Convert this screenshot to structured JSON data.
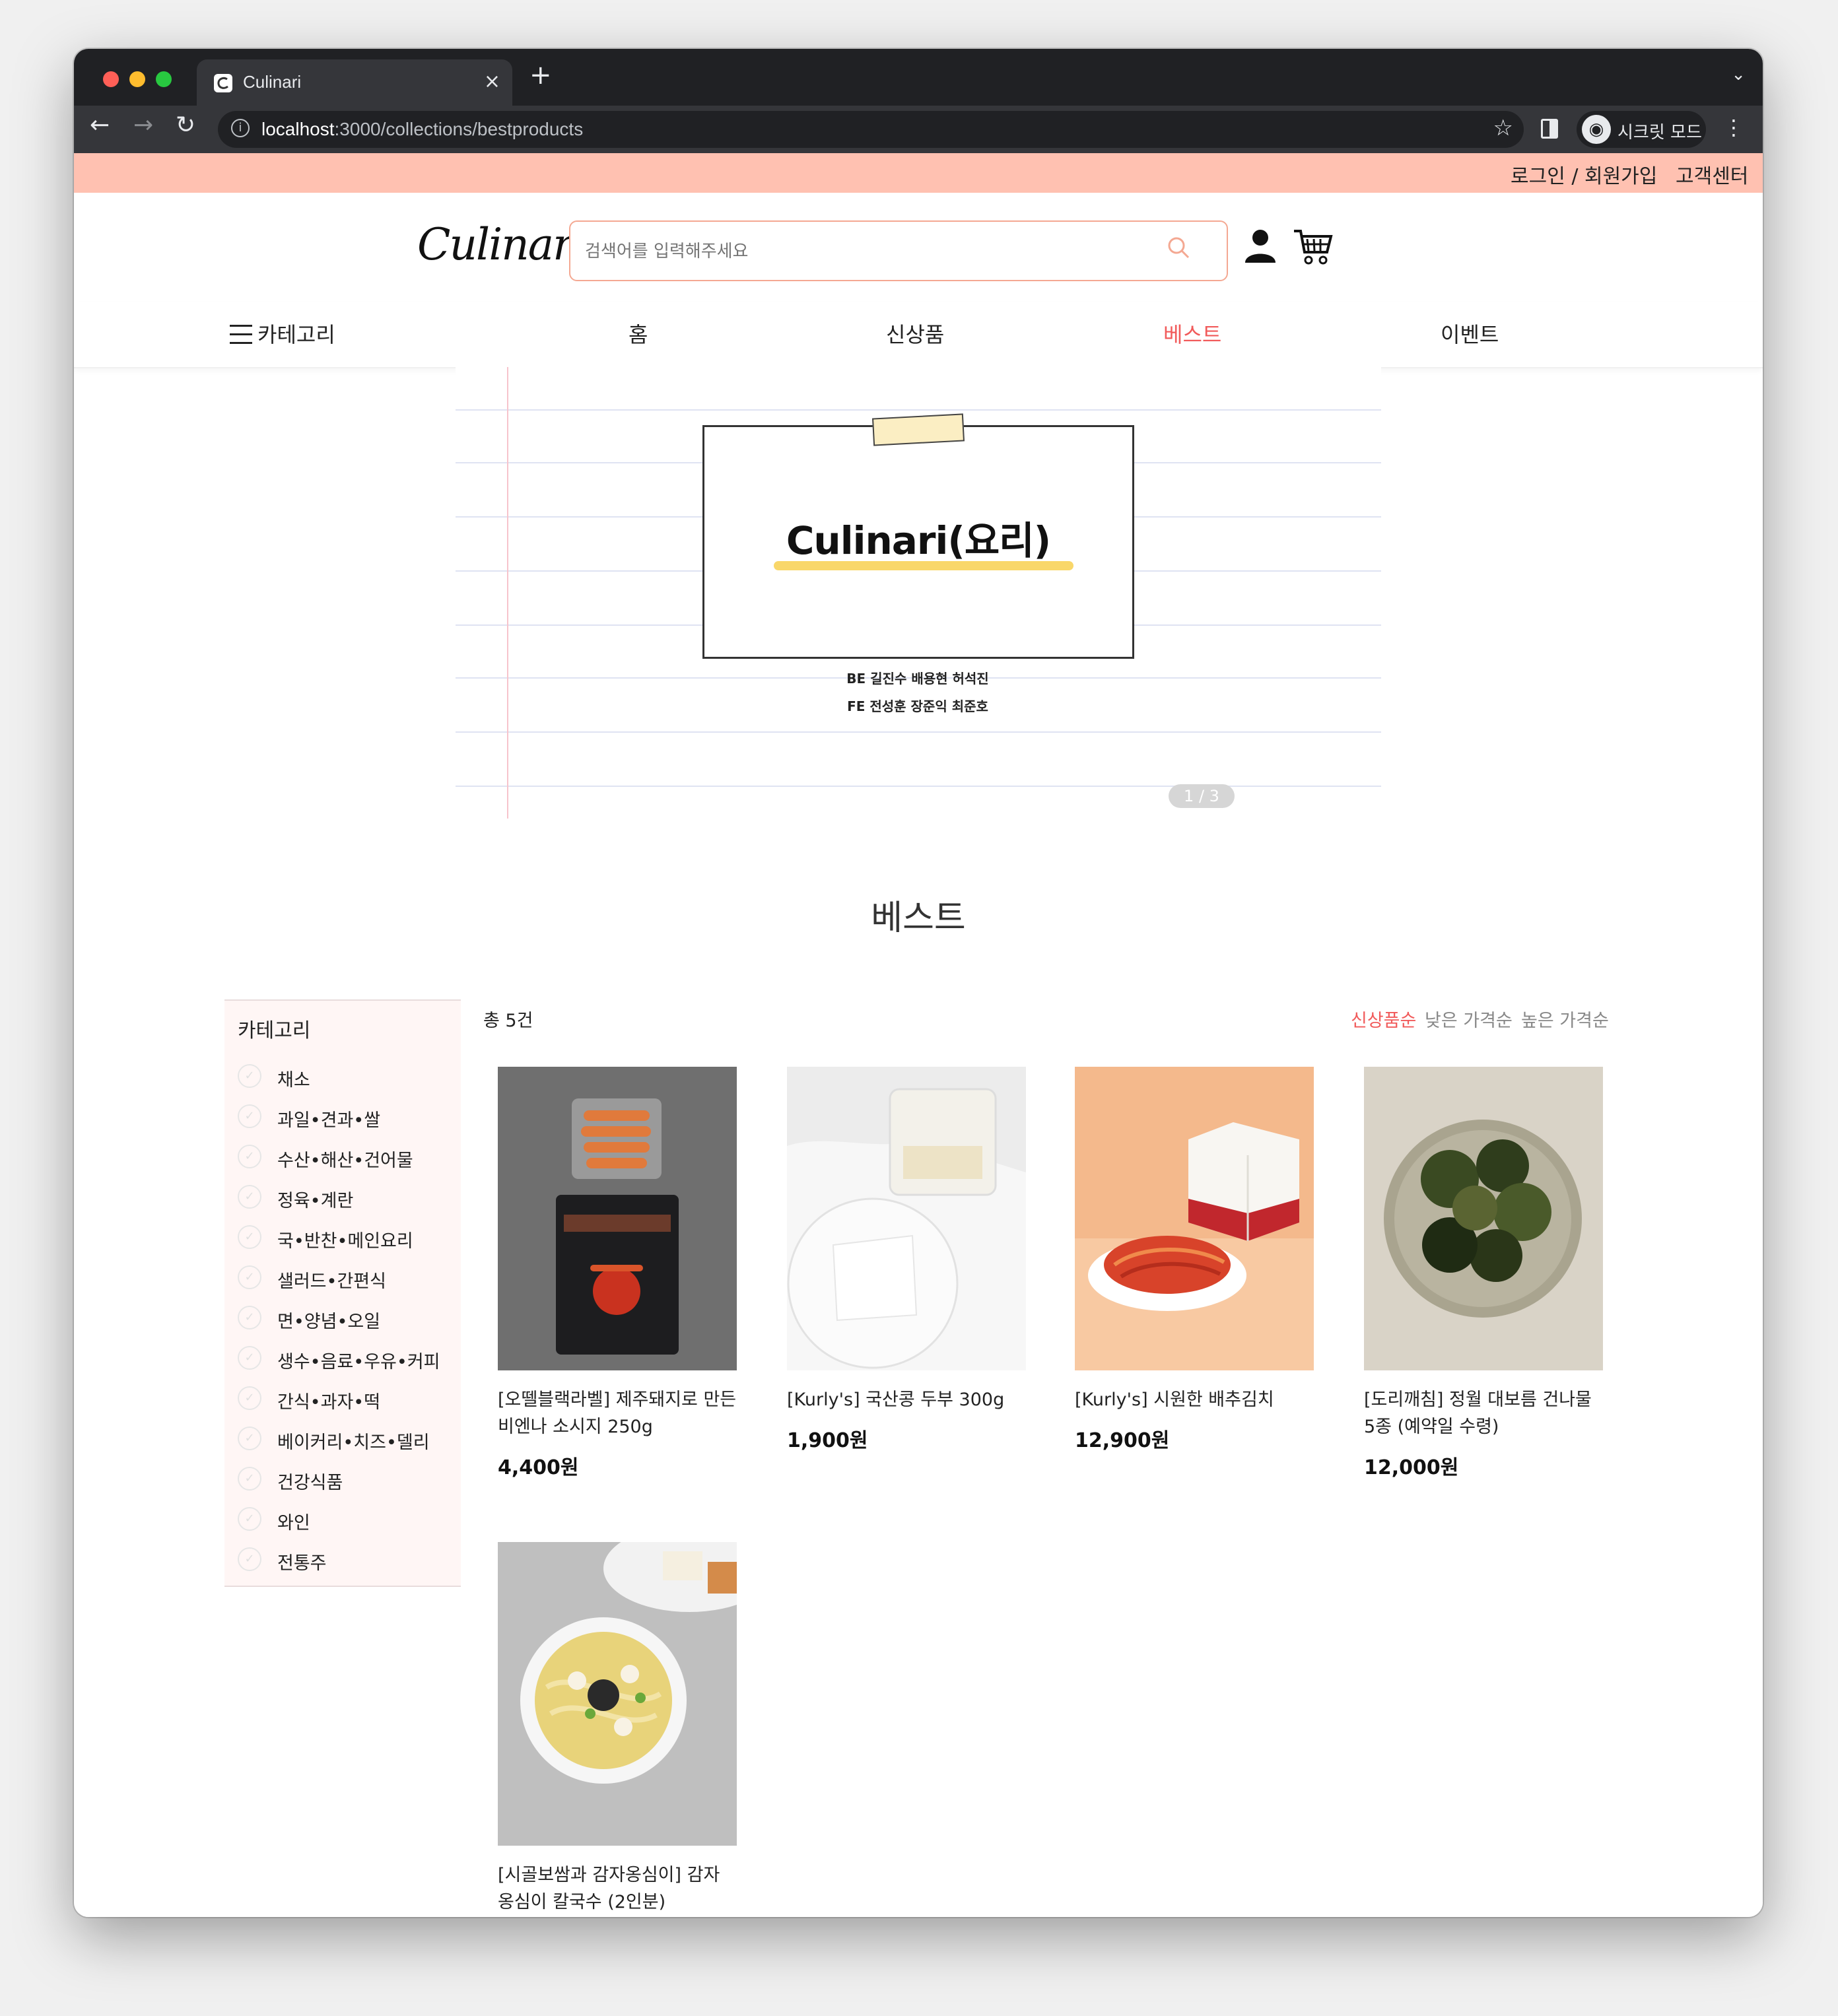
{
  "browser": {
    "tab_title": "Culinari",
    "tab_close": "×",
    "new_tab": "+",
    "tab_menu": "⌄",
    "url_host": "localhost",
    "url_path": ":3000/collections/bestproducts",
    "incognito_label": "시크릿 모드"
  },
  "topstrip": {
    "login": "로그인 / 회원가입",
    "support": "고객센터"
  },
  "header": {
    "logo": "Culinari",
    "search_placeholder": "검색어를 입력해주세요"
  },
  "gnb": {
    "category": "카테고리",
    "items": [
      "홈",
      "신상품",
      "베스트",
      "이벤트"
    ],
    "active": "베스트"
  },
  "banner": {
    "title": "Culinari(요리)",
    "credits_be": "BE 길진수 배용현 허석진",
    "credits_fe": "FE 전성훈 장준익 최준호",
    "pager": "1 / 3",
    "page_number": "1"
  },
  "section": {
    "title": "베스트",
    "total": "총 5건",
    "sort": [
      "신상품순",
      "낮은 가격순",
      "높은 가격순"
    ]
  },
  "sidebar": {
    "title": "카테고리",
    "items": [
      "채소",
      "과일•견과•쌀",
      "수산•해산•건어물",
      "정육•계란",
      "국•반찬•메인요리",
      "샐러드•간편식",
      "면•양념•오일",
      "생수•음료•우유•커피",
      "간식•과자•떡",
      "베이커리•치즈•델리",
      "건강식품",
      "와인",
      "전통주"
    ]
  },
  "products": [
    {
      "name": "[오뗄블랙라벨] 제주돼지로 만든 비엔나 소시지 250g",
      "price": "4,400원"
    },
    {
      "name": "[Kurly's] 국산콩 두부 300g",
      "price": "1,900원"
    },
    {
      "name": "[Kurly's] 시원한 배추김치",
      "price": "12,900원"
    },
    {
      "name": "[도리깨침] 정월 대보름 건나물 5종 (예약일 수령)",
      "price": "12,000원"
    },
    {
      "name": "[시골보쌈과 감자옹심이] 감자 옹심이 칼국수 (2인분)",
      "price": ""
    }
  ],
  "colors": {
    "accent": "#f15a5a",
    "topstrip": "#ffc1b1",
    "sidebar_bg": "#fff6f5"
  }
}
